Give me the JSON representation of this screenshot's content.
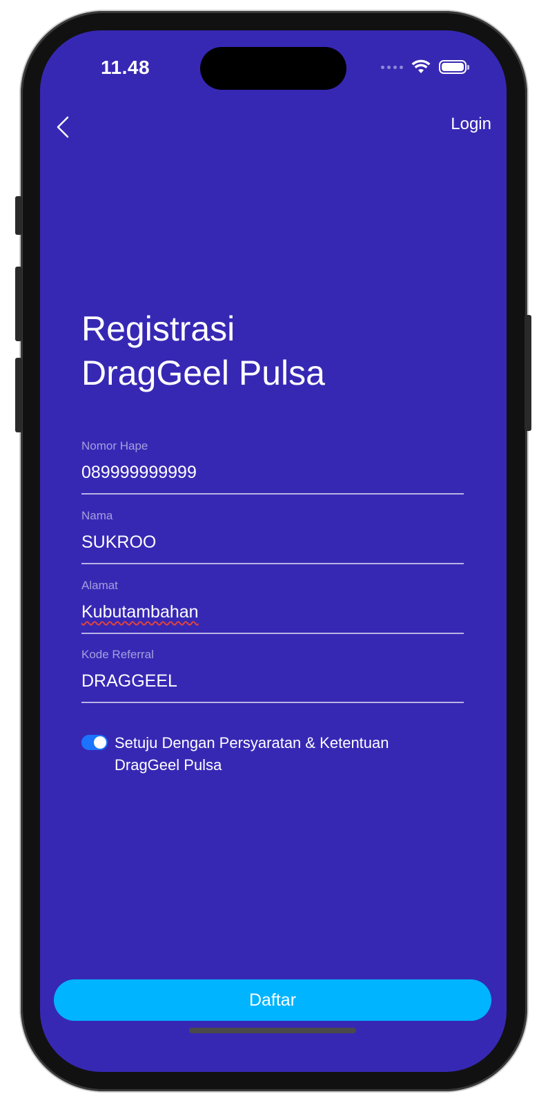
{
  "status_bar": {
    "time": "11.48"
  },
  "nav": {
    "back_icon": "chevron-left-icon",
    "login_label": "Login"
  },
  "page": {
    "title_line1": "Registrasi",
    "title_line2": "DragGeel Pulsa"
  },
  "form": {
    "fields": [
      {
        "label": "Nomor Hape",
        "value": "089999999999"
      },
      {
        "label": "Nama",
        "value": "SUKROO"
      },
      {
        "label": "Alamat",
        "value": "Kubutambahan"
      },
      {
        "label": "Kode Referral",
        "value": "DRAGGEEL"
      }
    ],
    "agreement": {
      "checked": true,
      "text": "Setuju Dengan Persyaratan & Ketentuan DragGeel Pulsa"
    },
    "submit_label": "Daftar"
  },
  "colors": {
    "background": "#3728b4",
    "button": "#00b4ff",
    "toggle": "#1b74ff"
  }
}
